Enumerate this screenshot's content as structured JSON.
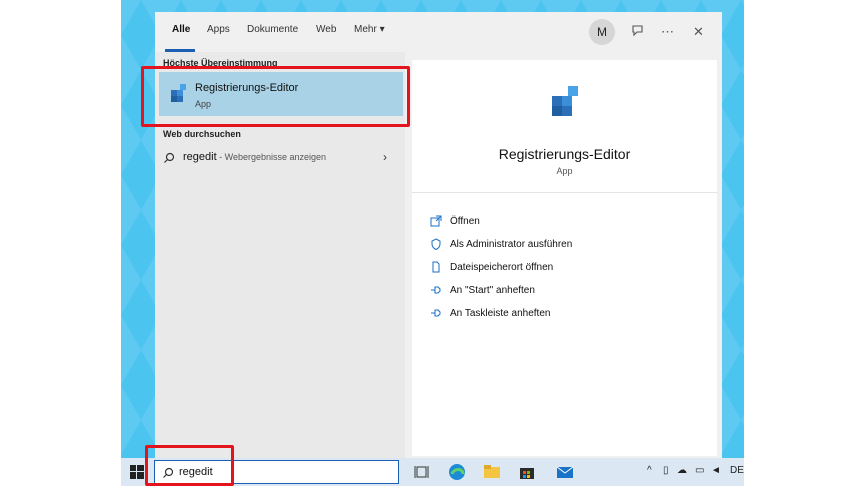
{
  "tabs": [
    "Alle",
    "Apps",
    "Dokumente",
    "Web",
    "Mehr"
  ],
  "header": {
    "avatar_letter": "M",
    "more_glyph": "⋯",
    "close_glyph": "✕"
  },
  "best_match": {
    "section": "Höchste Übereinstimmung",
    "title": "Registrierungs-Editor",
    "subtitle": "App"
  },
  "web": {
    "section": "Web durchsuchen",
    "query": "regedit",
    "suffix": " - Webergebnisse anzeigen"
  },
  "detail": {
    "title": "Registrierungs-Editor",
    "subtitle": "App",
    "actions": [
      {
        "label": "Öffnen",
        "icon": "open-icon"
      },
      {
        "label": "Als Administrator ausführen",
        "icon": "shield-icon"
      },
      {
        "label": "Dateispeicherort öffnen",
        "icon": "file-location-icon"
      },
      {
        "label": "An \"Start\" anheften",
        "icon": "pin-icon"
      },
      {
        "label": "An Taskleiste anheften",
        "icon": "pin-icon"
      }
    ]
  },
  "taskbar": {
    "search_value": "regedit",
    "tray_lang": "DE"
  },
  "colors": {
    "highlight": "#e3141e",
    "selected_row": "#a9d2e6",
    "accent": "#1a5fb4",
    "desktop": "#4cc4f0"
  }
}
